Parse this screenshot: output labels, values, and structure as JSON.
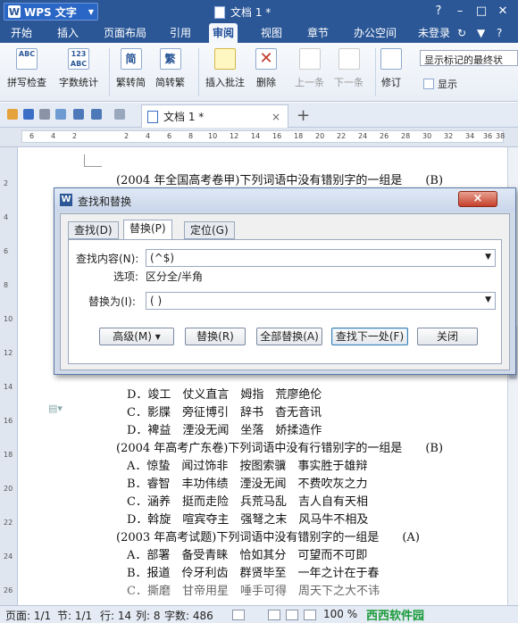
{
  "app": {
    "name": "WPS 文字",
    "logo": "W"
  },
  "window": {
    "doc_title": "文档 1 *"
  },
  "menu": {
    "tabs": [
      "开始",
      "插入",
      "页面布局",
      "引用",
      "审阅",
      "视图",
      "章节",
      "办公空间"
    ],
    "active": "审阅",
    "login": "未登录"
  },
  "ribbon": {
    "spell_check": "拼写检查",
    "word_count": "字数统计",
    "trad_to_simp": "繁转简",
    "simp_to_trad": "简转繁",
    "insert_comment": "插入批注",
    "delete": "删除",
    "prev": "上一条",
    "next": "下一条",
    "revise": "修订",
    "display": "显示",
    "display_mode": "显示标记的最终状",
    "abc_icon_text": "ABC",
    "count_icon_text": "123\nABC",
    "trad_icon_text": "简",
    "simp_icon_text": "繁"
  },
  "tabstrip": {
    "doc_tab": "文档 1 *",
    "close": "×",
    "add": "+"
  },
  "ruler": {
    "top_numbers": [
      "6",
      "4",
      "2",
      "2",
      "4",
      "6",
      "8",
      "10",
      "12",
      "14",
      "16",
      "18",
      "20",
      "22",
      "24",
      "26",
      "28",
      "30",
      "32",
      "34",
      "36",
      "38"
    ],
    "side_numbers": [
      "2",
      "4",
      "6",
      "8",
      "10",
      "12",
      "14",
      "16",
      "18",
      "20",
      "22",
      "24",
      "26"
    ]
  },
  "document": {
    "lines": [
      "(2004 年全国高考卷甲)下列词语中没有错别字的一组是　　(B)",
      "D．竣工　仗义直言　姆指　荒廖绝伦",
      "C．影牒　旁征博引　辞书　杳无音讯",
      "D．裨益　湮没无闻　坐落　娇揉造作",
      "(2004 年高考广东卷)下列词语中没有行错别字的一组是　　(B)",
      "A．惊蛰　闻过饰非　按图索骥　事实胜于雄辩",
      "B．睿智　丰功伟绩　湮没无闻　不费吹灰之力",
      "C．涵养　挺而走险　兵荒马乱　吉人自有天相",
      "D．斡旋　喧宾夺主　强弩之末　风马牛不相及",
      "(2003 年高考试题)下列词语中没有错别字的一组是　　(A)",
      "A．部署　备受青睐　恰如其分　可望而不可即",
      "B．报道　伶牙利齿　群贤毕至　一年之计在于春",
      "C．撕磨　甘帝用星　唾手可得　周天下之大不讳"
    ]
  },
  "dialog": {
    "title": "查找和替换",
    "close": "×",
    "tabs": [
      "查找(D)",
      "替换(P)",
      "定位(G)"
    ],
    "active_tab": "替换(P)",
    "find_label": "查找内容(N):",
    "find_value": "(^$)",
    "options_label": "选项:",
    "options_value": "区分全/半角",
    "replace_label": "替换为(I):",
    "replace_value": "( )",
    "buttons": {
      "advanced": "高级(M) ▾",
      "replace": "替换(R)",
      "replace_all": "全部替换(A)",
      "find_next": "查找下一处(F)",
      "close": "关闭"
    }
  },
  "status": {
    "page": "页面: 1/1",
    "section": "节: 1/1",
    "row": "行: 14",
    "col": "列: 8",
    "words": "字数: 486",
    "zoom": "100 %"
  },
  "watermark": "西西软件园"
}
